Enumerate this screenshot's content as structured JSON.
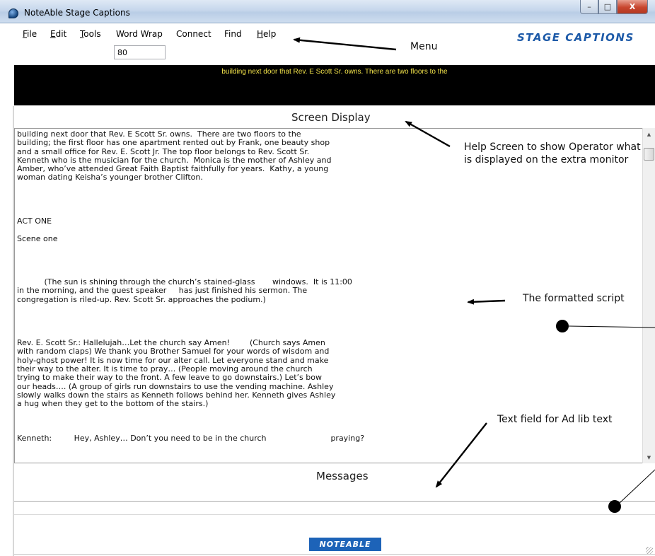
{
  "window": {
    "title": "NoteAble Stage Captions",
    "controls": {
      "minimize": "–",
      "maximize": "□",
      "close": "X"
    }
  },
  "menu": {
    "items": [
      {
        "label": "File",
        "underline": "F",
        "rest": "ile"
      },
      {
        "label": "Edit",
        "underline": "E",
        "rest": "dit"
      },
      {
        "label": "Tools",
        "underline": "T",
        "rest": "ools"
      },
      {
        "label": "Word Wrap",
        "underline": "",
        "rest": "Word Wrap"
      },
      {
        "label": "Connect",
        "underline": "",
        "rest": "Connect"
      },
      {
        "label": "Find",
        "underline": "",
        "rest": "Find"
      },
      {
        "label": "Help",
        "underline": "H",
        "rest": "elp"
      }
    ],
    "word_wrap_value": "80"
  },
  "brand": {
    "stage_captions_logo": "STAGE CAPTIONS",
    "noteable_logo": "NOTEABLE",
    "logo_color": "#1d5aa8"
  },
  "caption_bar": {
    "text": "building next door that Rev. E Scott Sr. owns.  There are two floors to the",
    "text_color": "#f3e34a",
    "background": "#000000"
  },
  "labels": {
    "screen_display": "Screen Display",
    "messages": "Messages"
  },
  "script": {
    "lines": [
      "building next door that Rev. E Scott Sr. owns.  There are two floors to the",
      "building; the first floor has one apartment rented out by Frank, one beauty shop",
      "and a small office for Rev. E. Scott Jr. The top floor belongs to Rev. Scott Sr.",
      "Kenneth who is the musician for the church.  Monica is the mother of Ashley and",
      "Amber, who’ve attended Great Faith Baptist faithfully for years.  Kathy, a young",
      "woman dating Keisha’s younger brother Clifton.",
      "",
      "",
      "",
      "",
      "ACT ONE",
      "",
      "Scene one",
      "",
      "",
      "",
      "",
      "           (The sun is shining through the church’s stained-glass       windows.  It is 11:00",
      "in the morning, and the guest speaker     has just finished his sermon. The",
      "congregation is riled-up. Rev. Scott Sr. approaches the podium.)",
      "",
      "",
      "",
      "",
      "Rev. E. Scott Sr.: Hallelujah…Let the church say Amen!        (Church says Amen",
      "with random claps) We thank you Brother Samuel for your words of wisdom and",
      "holy-ghost power! It is now time for our alter call. Let everyone stand and make",
      "their way to the alter. It is time to pray… (People moving around the church",
      "trying to make their way to the front. A few leave to go downstairs.) Let’s bow",
      "our heads…. (A group of girls run downstairs to use the vending machine. Ashley",
      "slowly walks down the stairs as Kenneth follows behind her. Kenneth gives Ashley",
      "a hug when they get to the bottom of the stairs.)",
      "",
      "",
      "",
      "Kenneth:         Hey, Ashley… Don’t you need to be in the church                          praying?"
    ]
  },
  "annotations": {
    "menu": "Menu",
    "help_screen": "Help Screen to show Operator what is displayed on the extra monitor",
    "formatted_script": "The formatted script",
    "ad_lib": "Text field for Ad lib text"
  }
}
